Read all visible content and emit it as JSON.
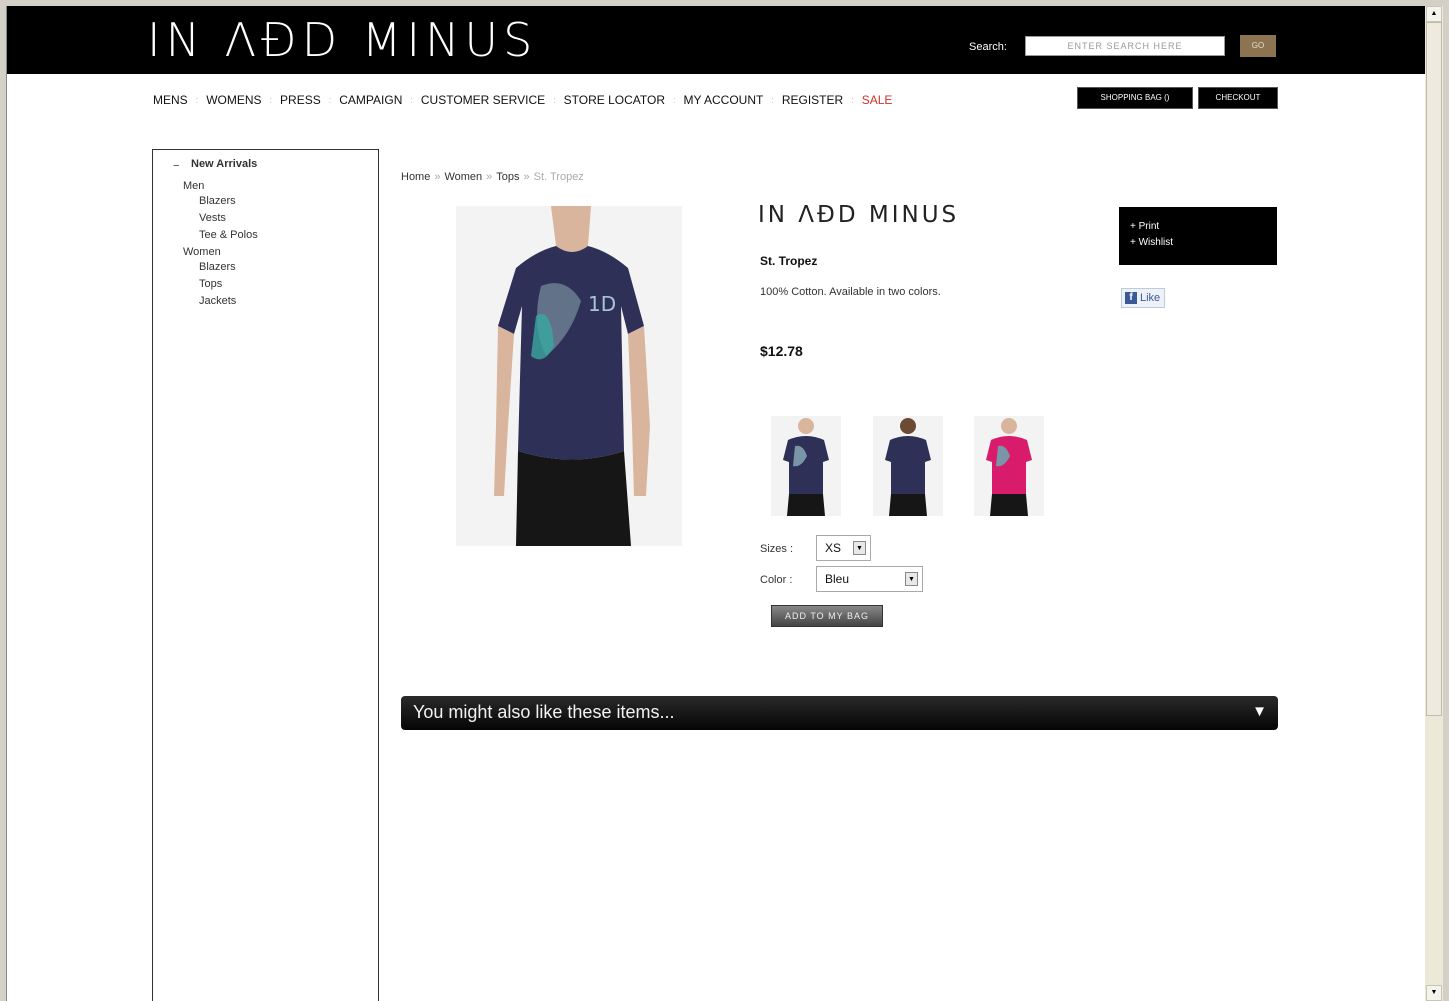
{
  "header": {
    "logo": "IN ΛÐD MINUS",
    "search_label": "Search:",
    "search_placeholder": "ENTER SEARCH HERE",
    "go_label": "GO"
  },
  "nav": {
    "items": [
      "MENS",
      "WOMENS",
      "PRESS",
      "CAMPAIGN",
      "CUSTOMER SERVICE",
      "STORE LOCATOR",
      "MY ACCOUNT",
      "REGISTER",
      "SALE"
    ],
    "separator": ":",
    "shopping_bag_label": "SHOPPING BAG ()",
    "checkout_label": "CHECKOUT",
    "sale_color": "#d0302a"
  },
  "sidebar": {
    "toggle": "−",
    "title": "New Arrivals",
    "men": "Men",
    "men_items": [
      "Blazers",
      "Vests",
      "Tee & Polos"
    ],
    "women": "Women",
    "women_items": [
      "Blazers",
      "Tops",
      "Jackets"
    ]
  },
  "breadcrumb": {
    "items": [
      "Home",
      "Women",
      "Tops"
    ],
    "current": "St. Tropez",
    "separator": "»"
  },
  "product": {
    "brand": "IN ΛÐD MINUS",
    "name": "St. Tropez",
    "description": "100% Cotton. Available in two colors.",
    "price": "$12.78",
    "size_label": "Sizes :",
    "size_value": "XS",
    "color_label": "Color :",
    "color_value": "Bleu",
    "add_to_bag_label": "ADD TO MY BAG",
    "thumb_colors": [
      "#2e3057",
      "#2e3057",
      "#d81b6a"
    ]
  },
  "tools": {
    "print": "+ Print",
    "wishlist": "+ Wishlist",
    "like": "Like"
  },
  "also_like": {
    "label": "You might also like these items...",
    "arrow": "▼"
  }
}
